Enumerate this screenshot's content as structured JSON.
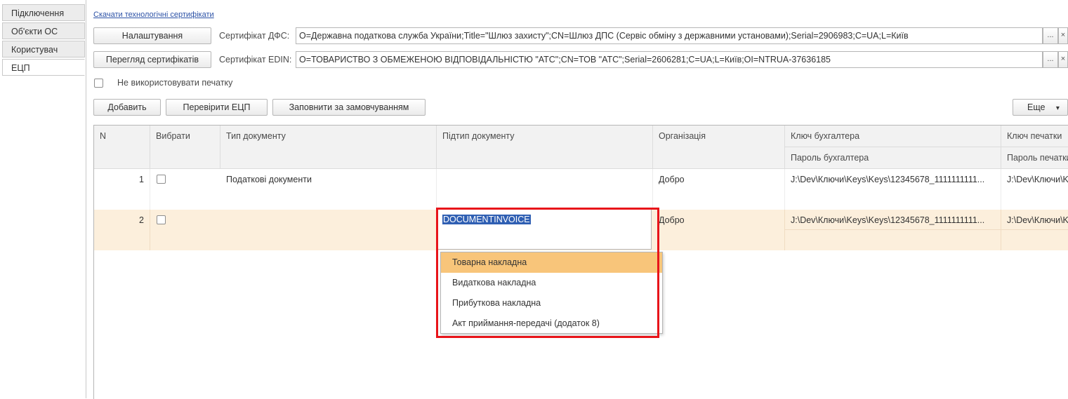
{
  "tabs": [
    {
      "label": "Підключення",
      "active": false
    },
    {
      "label": "Об'єкти ОС",
      "active": false
    },
    {
      "label": "Користувач",
      "active": false
    },
    {
      "label": "ЕЦП",
      "active": true
    }
  ],
  "top_link": "Скачати технологічні сертифікати",
  "settings_button": "Налаштування",
  "view_certs_button": "Перегляд сертифікатів",
  "cert_dfs": {
    "label": "Сертифікат ДФС:",
    "value": "O=Державна податкова служба України;Title=\"Шлюз захисту\";CN=Шлюз ДПС (Сервіс обміну з державними установами);Serial=2906983;C=UA;L=Київ"
  },
  "cert_edin": {
    "label": "Сертифікат EDIN:",
    "value": "O=ТОВАРИСТВО З ОБМЕЖЕНОЮ ВІДПОВІДАЛЬНІСТЮ \"АТС\";CN=ТОВ \"АТС\";Serial=2606281;C=UA;L=Київ;OI=NTRUA-37636185"
  },
  "field_buttons": {
    "select": "...",
    "clear": "×"
  },
  "no_stamp_label": "Не використовувати печатку",
  "toolbar": {
    "add": "Добавить",
    "check": "Перевірити ЕЦП",
    "fill_default": "Заповнити за замовчуванням",
    "more": "Еще",
    "more_arrow": "▾"
  },
  "table": {
    "headers": {
      "n": "N",
      "select": "Вибрати",
      "doc_type": "Тип документу",
      "doc_subtype": "Підтип документу",
      "org": "Організація",
      "acc_key": "Ключ бухгалтера",
      "acc_pass": "Пароль бухгалтера",
      "stamp_key": "Ключ печатки",
      "stamp_pass": "Пароль печатки"
    },
    "rows": [
      {
        "n": "1",
        "doc_type": "Податкові документи",
        "doc_subtype": "",
        "org": "Добро",
        "acc_key": "J:\\Dev\\Ключи\\Keys\\Keys\\12345678_1111111111...",
        "stamp_key": "J:\\Dev\\Ключи\\Key"
      },
      {
        "n": "2",
        "doc_type": "",
        "doc_subtype": "DOCUMENTINVOICE",
        "org": "Добро",
        "acc_key": "J:\\Dev\\Ключи\\Keys\\Keys\\12345678_1111111111...",
        "stamp_key": "J:\\Dev\\Ключи\\Key"
      }
    ]
  },
  "dropdown": [
    {
      "label": "Товарна накладна",
      "highlighted": true
    },
    {
      "label": "Видаткова накладна",
      "highlighted": false
    },
    {
      "label": "Прибуткова накладна",
      "highlighted": false
    },
    {
      "label": "Акт приймання-передачі (додаток 8)",
      "highlighted": false
    }
  ],
  "colors": {
    "highlight_box": "#e8141a",
    "row_selected": "#fcefdc",
    "dropdown_hover": "#f8c57a",
    "text_selection": "#2f5fb3"
  }
}
